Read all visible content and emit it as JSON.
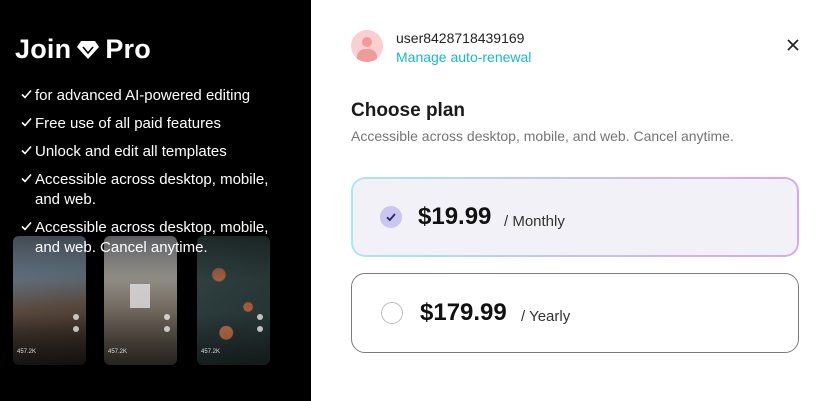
{
  "promo": {
    "title_left": "Join",
    "title_right": "Pro",
    "features": [
      "for advanced AI-powered editing",
      "Free use of all paid features",
      "Unlock and edit all templates",
      "Accessible across desktop, mobile, and web.",
      "Accessible across desktop, mobile, and web. Cancel anytime."
    ],
    "thumbs": [
      {
        "likes": "457.2K"
      },
      {
        "likes": "457.2K"
      },
      {
        "likes": "457.2K"
      }
    ]
  },
  "account": {
    "username": "user8428718439169",
    "manage_label": "Manage auto-renewal"
  },
  "plans": {
    "title": "Choose plan",
    "subtitle": "Accessible across desktop, mobile, and web. Cancel anytime.",
    "options": [
      {
        "price": "$19.99",
        "period": "/ Monthly",
        "selected": true
      },
      {
        "price": "$179.99",
        "period": "/ Yearly",
        "selected": false
      }
    ]
  },
  "icons": {
    "gem": "gem-icon",
    "check": "check-icon",
    "close": "close-icon"
  },
  "colors": {
    "accent": "#1ab7c9",
    "selected_bg": "#f2f1f8",
    "radio_selected": "#c9c6f1"
  }
}
